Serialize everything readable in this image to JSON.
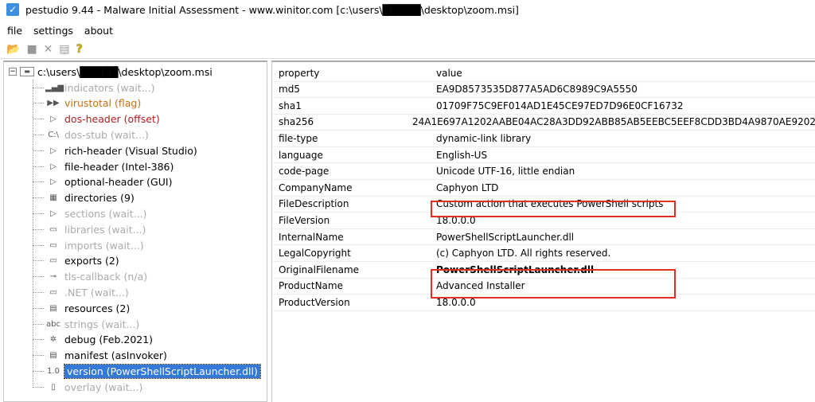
{
  "window": {
    "title": "pestudio 9.44 - Malware Initial Assessment - www.winitor.com [c:\\users\\█████\\desktop\\zoom.msi]"
  },
  "menu": [
    "file",
    "settings",
    "about"
  ],
  "toolbar": {
    "icons": [
      "open-icon",
      "save-icon",
      "close-icon",
      "clipboard-icon",
      "help-icon"
    ],
    "help_glyph": "?"
  },
  "tree": {
    "root": "c:\\users\\█████\\desktop\\zoom.msi",
    "items": [
      {
        "label": "indicators (wait...)",
        "style": "wait",
        "icon": "indicators-icon",
        "glyph": "▂▄▆"
      },
      {
        "label": "virustotal (flag)",
        "style": "orange",
        "icon": "virustotal-icon",
        "glyph": "▶▶"
      },
      {
        "label": "dos-header (offset)",
        "style": "red",
        "icon": "expand-icon",
        "glyph": "▷"
      },
      {
        "label": "dos-stub (wait...)",
        "style": "wait",
        "icon": "console-icon",
        "glyph": "C:\\"
      },
      {
        "label": "rich-header (Visual Studio)",
        "style": "",
        "icon": "expand-icon",
        "glyph": "▷"
      },
      {
        "label": "file-header (Intel-386)",
        "style": "",
        "icon": "expand-icon",
        "glyph": "▷"
      },
      {
        "label": "optional-header (GUI)",
        "style": "",
        "icon": "expand-icon",
        "glyph": "▷"
      },
      {
        "label": "directories (9)",
        "style": "",
        "icon": "directories-icon",
        "glyph": "▦"
      },
      {
        "label": "sections (wait...)",
        "style": "wait",
        "icon": "expand-icon",
        "glyph": "▷"
      },
      {
        "label": "libraries (wait...)",
        "style": "wait",
        "icon": "library-icon",
        "glyph": "▭"
      },
      {
        "label": "imports (wait...)",
        "style": "wait",
        "icon": "imports-icon",
        "glyph": "▭"
      },
      {
        "label": "exports (2)",
        "style": "",
        "icon": "exports-icon",
        "glyph": "▭"
      },
      {
        "label": "tls-callback (n/a)",
        "style": "wait",
        "icon": "key-icon",
        "glyph": "⊸"
      },
      {
        "label": ".NET (wait...)",
        "style": "wait",
        "icon": "dotnet-icon",
        "glyph": "▭"
      },
      {
        "label": "resources (2)",
        "style": "",
        "icon": "resources-icon",
        "glyph": "▤"
      },
      {
        "label": "strings (wait...)",
        "style": "wait",
        "icon": "strings-icon",
        "glyph": "abc"
      },
      {
        "label": "debug (Feb.2021)",
        "style": "",
        "icon": "bug-icon",
        "glyph": "✲"
      },
      {
        "label": "manifest (asInvoker)",
        "style": "",
        "icon": "manifest-icon",
        "glyph": "▤"
      },
      {
        "label": "version (PowerShellScriptLauncher.dll)",
        "style": "sel",
        "icon": "version-icon",
        "glyph": "1.0"
      },
      {
        "label": "overlay (wait...)",
        "style": "wait",
        "icon": "file-icon",
        "glyph": "▯"
      }
    ]
  },
  "table": {
    "headers": [
      "property",
      "value"
    ],
    "rows": [
      [
        "md5",
        "EA9D8573535D877A5AD6C8989C9A5550"
      ],
      [
        "sha1",
        "01709F75C9EF014AD1E45CE97ED7D96E0CF16732"
      ],
      [
        "sha256",
        "24A1E697A1202AABE04AC28A3DD92ABB85AB5EEBC5EEF8CDD3BD4A9870AE9202"
      ],
      [
        "file-type",
        "dynamic-link library"
      ],
      [
        "language",
        "English-US"
      ],
      [
        "code-page",
        "Unicode UTF-16, little endian"
      ],
      [
        "CompanyName",
        "Caphyon LTD"
      ],
      [
        "FileDescription",
        "Custom action that executes PowerShell scripts"
      ],
      [
        "FileVersion",
        "18.0.0.0"
      ],
      [
        "InternalName",
        "PowerShellScriptLauncher.dll"
      ],
      [
        "LegalCopyright",
        "(c) Caphyon LTD. All rights reserved."
      ],
      [
        "OriginalFilename",
        "PowerShellScriptLauncher.dll"
      ],
      [
        "ProductName",
        "Advanced Installer"
      ],
      [
        "ProductVersion",
        "18.0.0.0"
      ]
    ]
  },
  "highlight_color": "#e03020"
}
